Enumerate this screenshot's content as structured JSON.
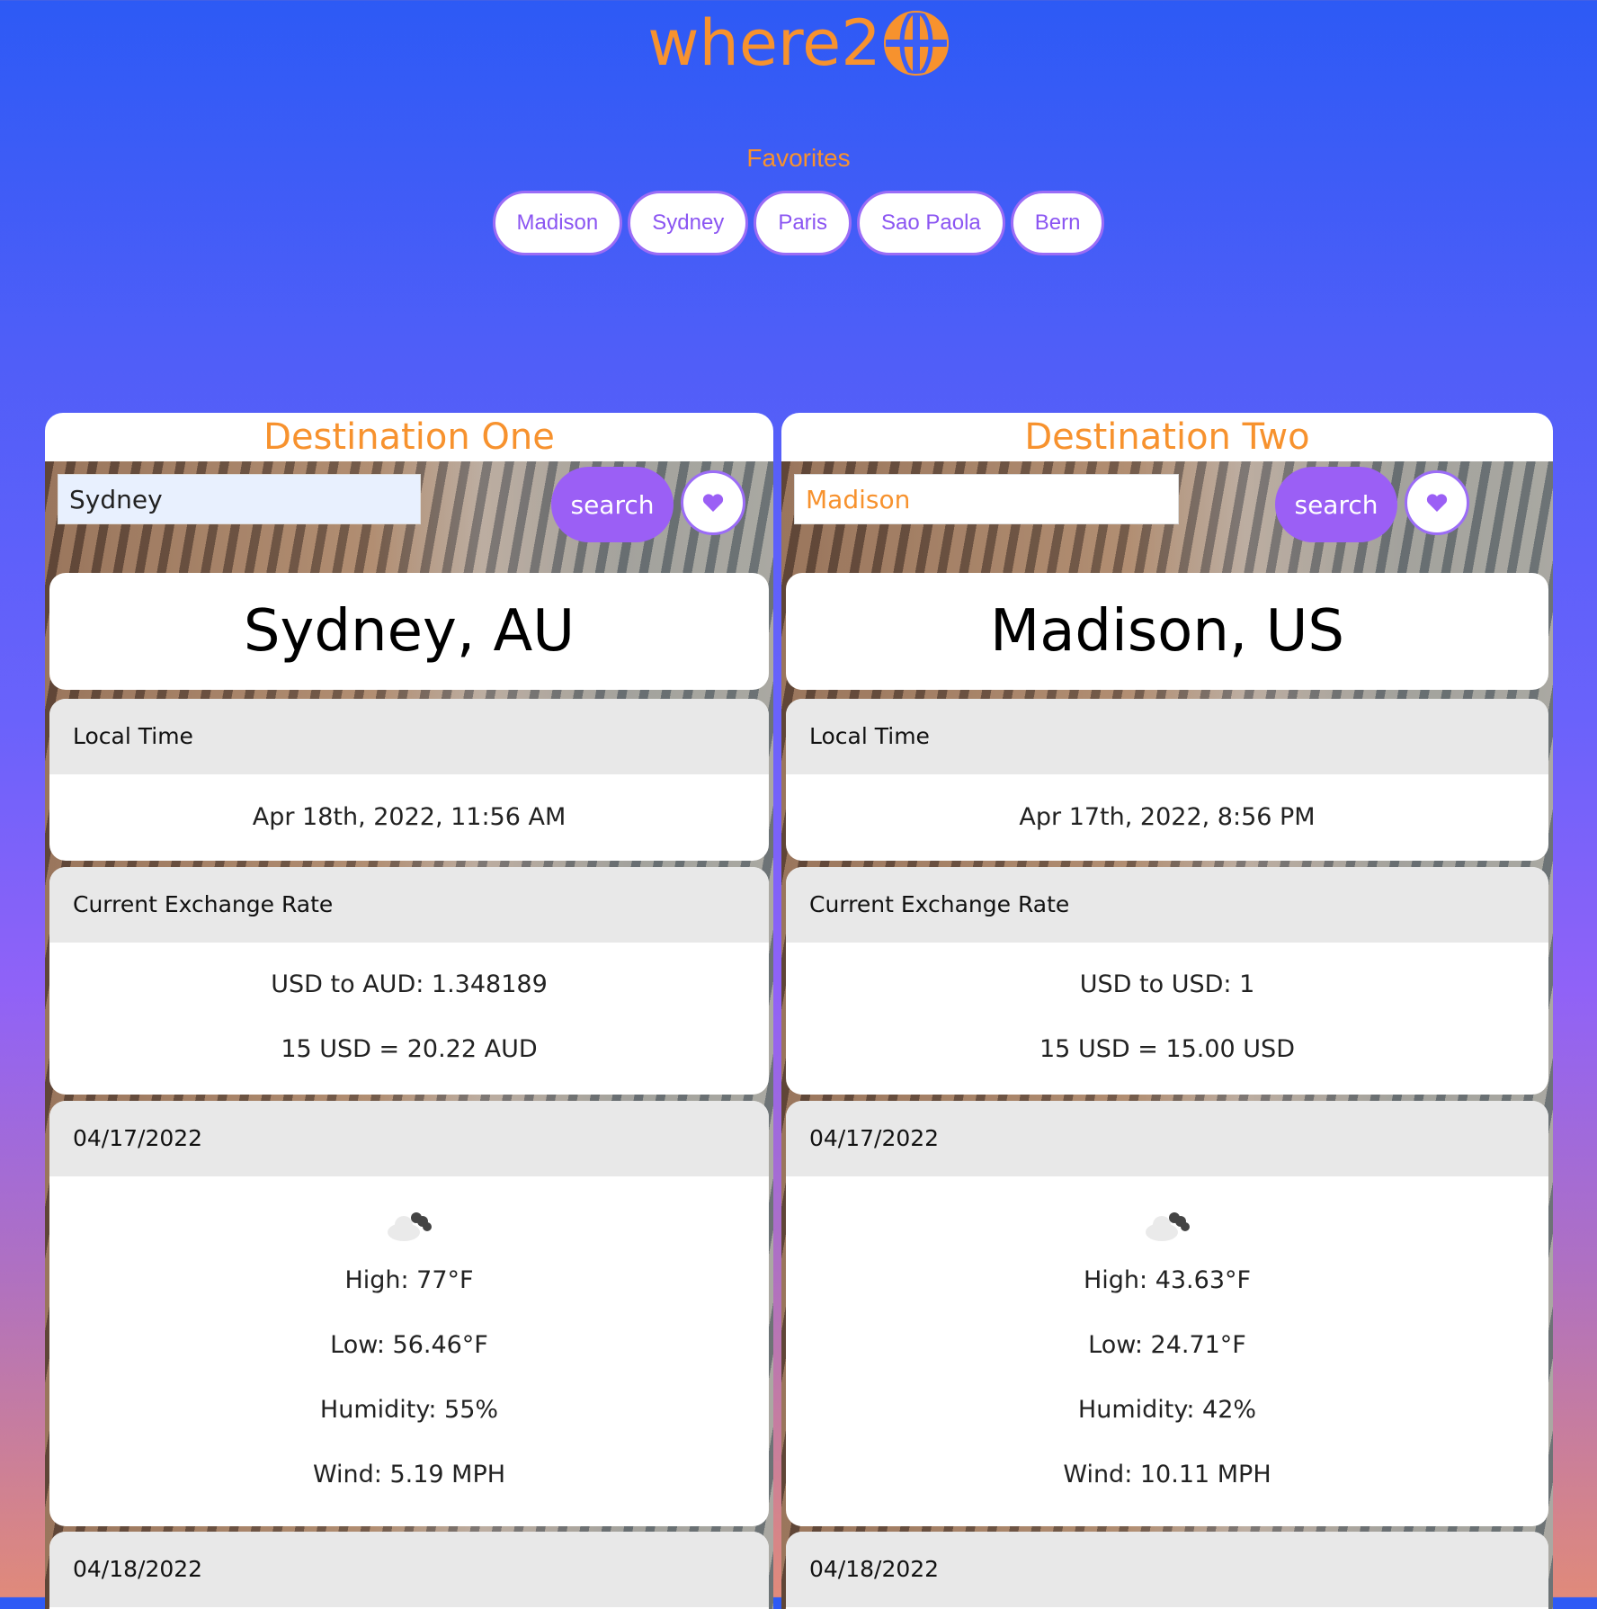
{
  "logo": {
    "text": "where2"
  },
  "favorites": {
    "title": "Favorites",
    "items": [
      "Madison",
      "Sydney",
      "Paris",
      "Sao Paola",
      "Bern"
    ]
  },
  "destinations": [
    {
      "heading": "Destination One",
      "search_value": "Sydney",
      "search_label": "search",
      "city": "Sydney, AU",
      "local_time_label": "Local Time",
      "local_time": "Apr 18th, 2022, 11:56 AM",
      "exchange_label": "Current Exchange Rate",
      "exchange_rate": "USD to AUD: 1.348189",
      "exchange_example": "15 USD = 20.22 AUD",
      "days": [
        {
          "date": "04/17/2022",
          "high": "High: 77°F",
          "low": "Low: 56.46°F",
          "humidity": "Humidity: 55%",
          "wind": "Wind: 5.19 MPH"
        },
        {
          "date": "04/18/2022"
        }
      ]
    },
    {
      "heading": "Destination Two",
      "search_placeholder": "Madison",
      "search_label": "search",
      "city": "Madison, US",
      "local_time_label": "Local Time",
      "local_time": "Apr 17th, 2022, 8:56 PM",
      "exchange_label": "Current Exchange Rate",
      "exchange_rate": "USD to USD: 1",
      "exchange_example": "15 USD = 15.00 USD",
      "days": [
        {
          "date": "04/17/2022",
          "high": "High: 43.63°F",
          "low": "Low: 24.71°F",
          "humidity": "Humidity: 42%",
          "wind": "Wind: 10.11 MPH"
        },
        {
          "date": "04/18/2022"
        }
      ]
    }
  ],
  "colors": {
    "accent_orange": "#f7922e",
    "accent_purple": "#9b5ff5"
  },
  "icons": {
    "favorite": "heart-icon",
    "weather": "cloudy-icon",
    "logo": "globe-icon"
  }
}
